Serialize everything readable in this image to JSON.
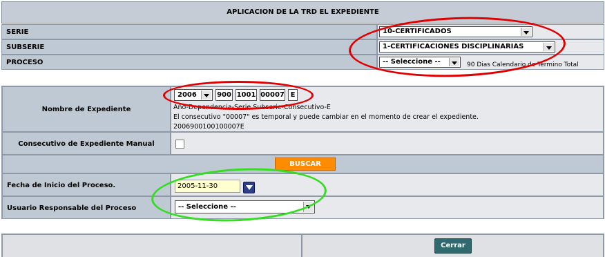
{
  "header": {
    "title": "APLICACION DE LA TRD EL EXPEDIENTE"
  },
  "trd": {
    "serie_label": "SERIE",
    "serie_value": "10-CERTIFICADOS",
    "subserie_label": "SUBSERIE",
    "subserie_value": "1-CERTIFICACIONES DISCIPLINARIAS",
    "proceso_label": "PROCESO",
    "proceso_value": "-- Seleccione --",
    "proceso_note": "90 Dias Calendario de Termino Total"
  },
  "expediente": {
    "label": "Nombre de Expediente",
    "year": "2006",
    "dep": "900",
    "serie_sub": "1001",
    "consecutivo": "00007",
    "suffix": "E",
    "format_hint": "Año-Dependencia-Serie Subserie-Consecutivo-E",
    "temp_note": "El consecutivo \"00007\" es temporal y puede cambiar en el momento de crear el expediente.",
    "full_number": "2006900100100007E",
    "manual_label": "Consecutivo de Expediente Manual",
    "manual_checked": false
  },
  "buscar_button": "BUSCAR",
  "proceso": {
    "fecha_label": "Fecha de Inicio del Proceso.",
    "fecha_value": "2005-11-30",
    "usuario_label": "Usuario Responsable del Proceso",
    "usuario_value": "-- Seleccione --"
  },
  "cerrar_button": "Cerrar",
  "colors": {
    "header_bg": "#c5ccd6",
    "buscar_bg": "#ff8c00",
    "cerrar_bg": "#2f6a6f",
    "red_annotation": "#e00000",
    "green_annotation": "#33dd22"
  }
}
